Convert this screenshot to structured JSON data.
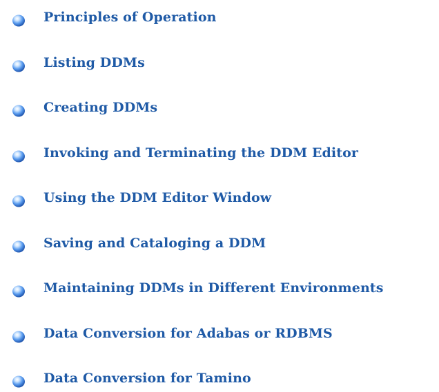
{
  "toc": {
    "bullet_icon": "blue-sphere-bullet-icon",
    "link_color": "#1f5aa6",
    "items": [
      {
        "label": "Principles of Operation"
      },
      {
        "label": "Listing DDMs"
      },
      {
        "label": "Creating DDMs"
      },
      {
        "label": "Invoking and Terminating the DDM Editor"
      },
      {
        "label": "Using the DDM Editor Window"
      },
      {
        "label": "Saving and Cataloging a DDM"
      },
      {
        "label": "Maintaining DDMs in Different Environments"
      },
      {
        "label": "Data Conversion for Adabas or RDBMS"
      },
      {
        "label": "Data Conversion for Tamino"
      }
    ]
  }
}
